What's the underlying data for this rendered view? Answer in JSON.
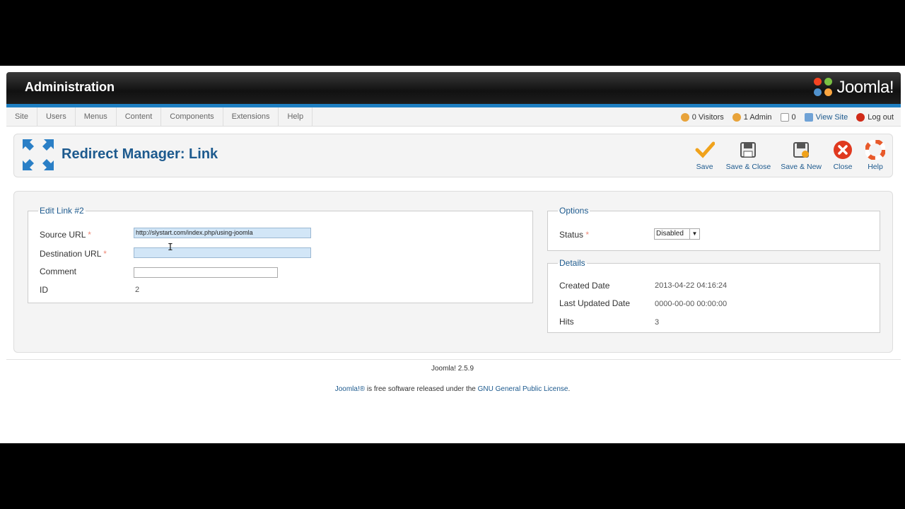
{
  "header": {
    "title": "Administration",
    "logo_text": "Joomla!"
  },
  "menu": [
    "Site",
    "Users",
    "Menus",
    "Content",
    "Components",
    "Extensions",
    "Help"
  ],
  "status": {
    "visitors": "0 Visitors",
    "admins": "1 Admin",
    "messages": "0",
    "view_site": "View Site",
    "logout": "Log out"
  },
  "toolbar": {
    "title": "Redirect Manager: Link",
    "buttons": [
      "Save",
      "Save & Close",
      "Save & New",
      "Close",
      "Help"
    ]
  },
  "edit": {
    "legend": "Edit Link #2",
    "source_label": "Source URL",
    "source_value": "http://slystart.com/index.php/using-joomla",
    "dest_label": "Destination URL",
    "dest_value": "",
    "comment_label": "Comment",
    "comment_value": "",
    "id_label": "ID",
    "id_value": "2",
    "required_mark": "*"
  },
  "options": {
    "legend": "Options",
    "status_label": "Status",
    "status_value": "Disabled"
  },
  "details": {
    "legend": "Details",
    "created_label": "Created Date",
    "created_value": "2013-04-22 04:16:24",
    "updated_label": "Last Updated Date",
    "updated_value": "0000-00-00 00:00:00",
    "hits_label": "Hits",
    "hits_value": "3"
  },
  "footer": {
    "version": "Joomla! 2.5.9",
    "license_link1": "Joomla!®",
    "license_text": " is free software released under the ",
    "license_link2": "GNU General Public License",
    "license_end": "."
  },
  "colors": {
    "accent": "#1d5a8e",
    "header": "#111111",
    "strip": "#1e7fc2"
  }
}
